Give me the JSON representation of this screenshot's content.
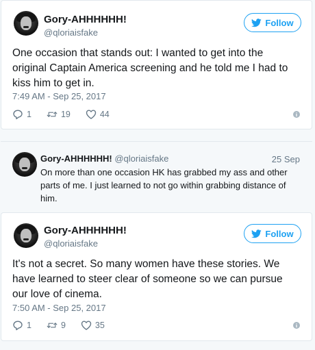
{
  "tweet1": {
    "name": "Gory-AHHHHHH!",
    "handle": "@qloriaisfake",
    "follow_label": "Follow",
    "text": "One occasion that stands out: I wanted to get into the original Captain America screening and he told me I had to kiss him to get in.",
    "timestamp": "7:49 AM - Sep 25, 2017",
    "replies": "1",
    "retweets": "19",
    "likes": "44"
  },
  "quoted": {
    "name": "Gory-AHHHHHH!",
    "handle": "@qloriaisfake",
    "date": "25 Sep",
    "text": "On more than one occasion HK has grabbed my ass and other parts of me. I just learned to not go within grabbing distance of him."
  },
  "tweet2": {
    "name": "Gory-AHHHHHH!",
    "handle": "@qloriaisfake",
    "follow_label": "Follow",
    "text": "It's not a secret. So many women have these stories. We have learned to steer clear of someone so we can pursue our love of cinema.",
    "timestamp": "7:50 AM - Sep 25, 2017",
    "replies": "1",
    "retweets": "9",
    "likes": "35"
  },
  "colors": {
    "twitter_blue": "#1da1f2",
    "muted_text": "#657786",
    "border": "#e1e8ed"
  },
  "icons": [
    "twitter-bird-icon",
    "reply-icon",
    "retweet-icon",
    "like-heart-icon",
    "info-icon"
  ]
}
